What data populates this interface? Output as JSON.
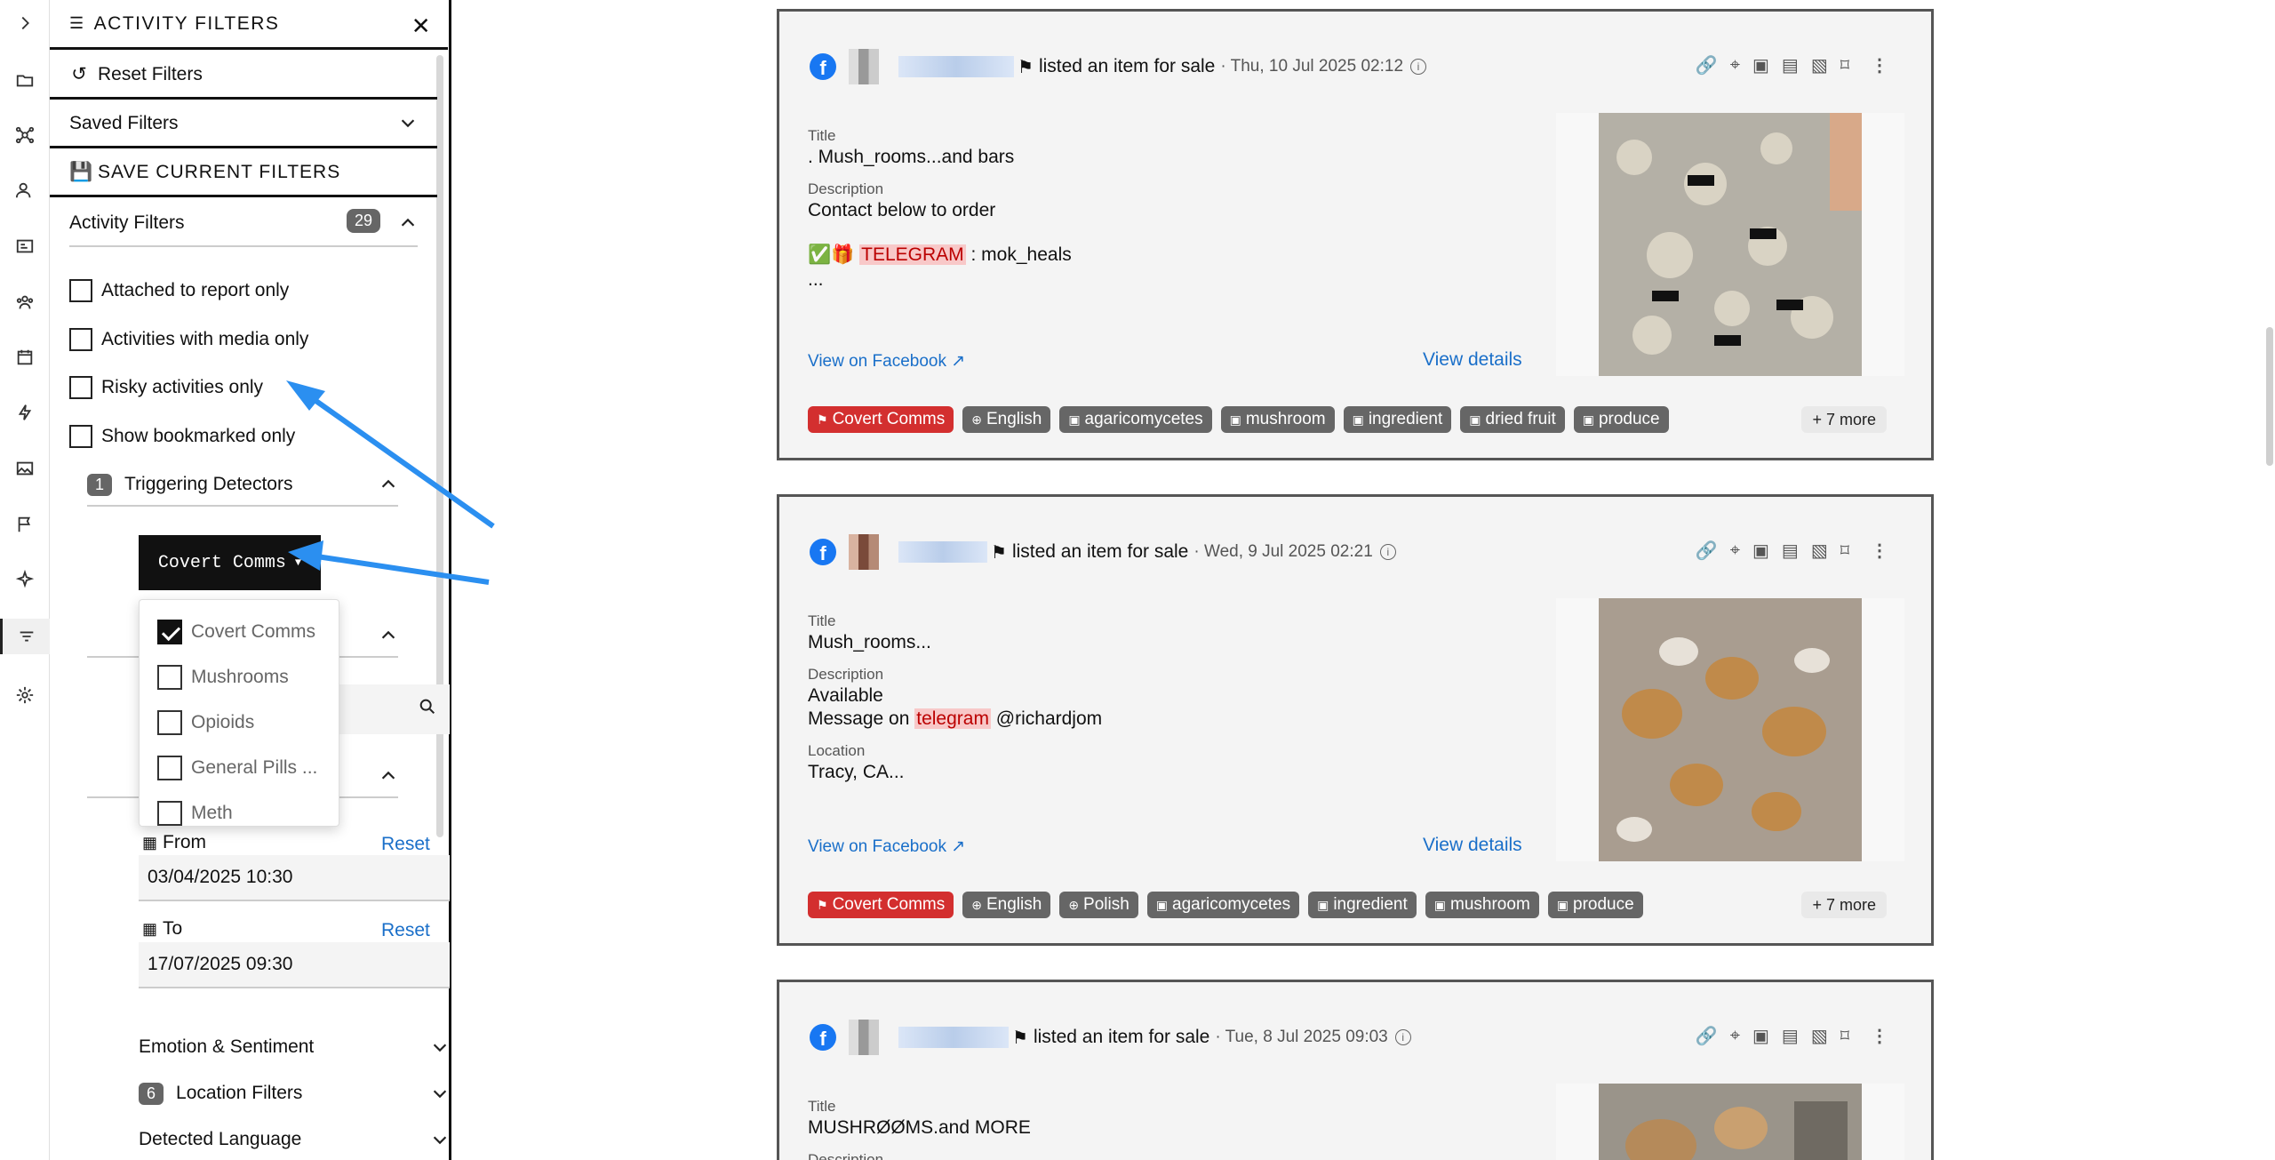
{
  "panel": {
    "title": "ACTIVITY FILTERS",
    "reset_filters": "Reset Filters",
    "saved_filters": "Saved Filters",
    "save_current": "SAVE CURRENT FILTERS",
    "activity_filters": "Activity Filters",
    "activity_count": "29",
    "checks": [
      "Attached to report only",
      "Activities with media only",
      "Risky activities only",
      "Show bookmarked only"
    ],
    "triggering": {
      "count": "1",
      "label": "Triggering Detectors"
    },
    "detector_button": "Covert Comms",
    "detector_options": [
      {
        "label": "Covert Comms",
        "checked": true
      },
      {
        "label": "Mushrooms",
        "checked": false
      },
      {
        "label": "Opioids",
        "checked": false
      },
      {
        "label": "General Pills ...",
        "checked": false
      },
      {
        "label": "Meth",
        "checked": false
      }
    ],
    "date": {
      "from_label": "From",
      "from_value": "03/04/2025 10:30",
      "from_reset": "Reset",
      "to_label": "To",
      "to_value": "17/07/2025 09:30",
      "to_reset": "Reset"
    },
    "emotion": "Emotion & Sentiment",
    "location": {
      "count": "6",
      "label": "Location Filters"
    },
    "language": "Detected Language"
  },
  "cards": [
    {
      "action": "listed an item for sale",
      "timestamp": "· Thu, 10 Jul 2025 02:12",
      "title_label": "Title",
      "title": ". Mush_rooms...and bars",
      "desc_label": "Description",
      "desc1": "Contact below to order",
      "desc2_pre": "✅🎁 ",
      "desc2_hl": "TELEGRAM",
      "desc2_post": " : mok_heals",
      "desc3": "...",
      "view_fb": "View on Facebook",
      "view_details": "View details",
      "tags": [
        "Covert Comms",
        "English",
        "agaricomycetes",
        "mushroom",
        "ingredient",
        "dried fruit",
        "produce"
      ],
      "more": "+ 7 more"
    },
    {
      "action": "listed an item for sale",
      "timestamp": "· Wed, 9 Jul 2025 02:21",
      "title_label": "Title",
      "title": "Mush_rooms...",
      "desc_label": "Description",
      "desc1": "Available",
      "desc2_pre": "Message on ",
      "desc2_hl": "telegram",
      "desc2_post": " @richardjom",
      "loc_label": "Location",
      "loc": "Tracy, CA...",
      "view_fb": "View on Facebook",
      "view_details": "View details",
      "tags": [
        "Covert Comms",
        "English",
        "Polish",
        "agaricomycetes",
        "ingredient",
        "mushroom",
        "produce"
      ],
      "more": "+ 7 more"
    },
    {
      "action": "listed an item for sale",
      "timestamp": "· Tue, 8 Jul 2025 09:03",
      "title_label": "Title",
      "title": "MUSHRØØMS.and MORE",
      "desc_label": "Description"
    }
  ],
  "colors": {
    "accent": "#1a6fc9",
    "highlight": "#f8c8c8",
    "danger": "#d32f2f",
    "arrow": "#2b8ff0"
  }
}
